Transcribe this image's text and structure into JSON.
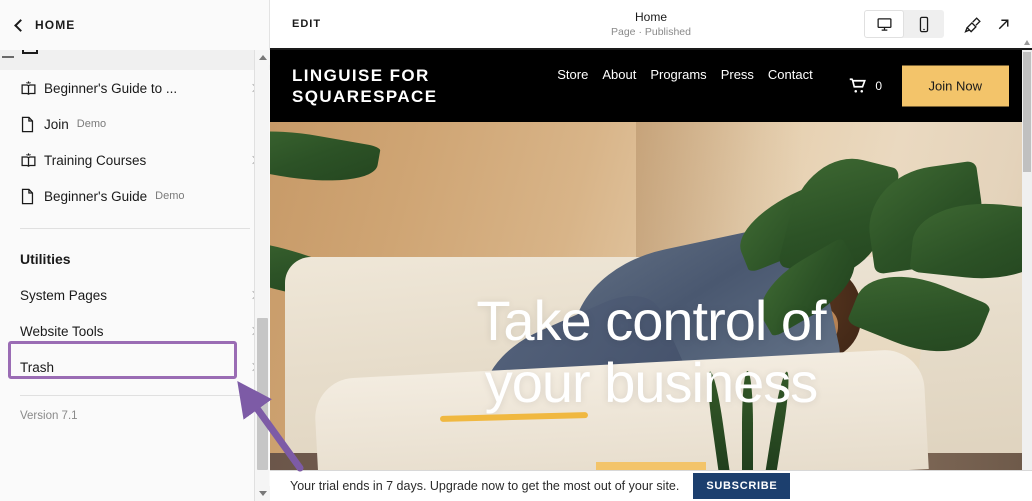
{
  "sidebar": {
    "back_label": "HOME",
    "back_icon": "chevron-left-icon",
    "nav_items": [
      {
        "label": "Beginner's Guide to ...",
        "icon": "book-icon",
        "badge": "",
        "has_chevron": true
      },
      {
        "label": "Join",
        "icon": "page-icon",
        "badge": "Demo",
        "has_chevron": false
      },
      {
        "label": "Training Courses",
        "icon": "book-icon",
        "badge": "",
        "has_chevron": true
      },
      {
        "label": "Beginner's Guide",
        "icon": "page-icon",
        "badge": "Demo",
        "has_chevron": false
      }
    ],
    "utilities_title": "Utilities",
    "utility_items": [
      {
        "label": "System Pages",
        "has_chevron": true,
        "highlighted": false
      },
      {
        "label": "Website Tools",
        "has_chevron": true,
        "highlighted": true
      },
      {
        "label": "Trash",
        "has_chevron": true,
        "highlighted": false
      }
    ],
    "version": "Version 7.1",
    "highlight_color": "#9a6cb4",
    "annotation_arrow_color": "#7d5ba6"
  },
  "topbar": {
    "edit_label": "EDIT",
    "page_title": "Home",
    "page_status": "Page · Published",
    "device_desktop_icon": "desktop-icon",
    "device_mobile_icon": "mobile-icon",
    "desktop_selected": true,
    "brush_icon": "paintbrush-icon",
    "open_icon": "external-link-icon"
  },
  "site": {
    "logo_line1": "LINGUISE FOR",
    "logo_line2": "SQUARESPACE",
    "nav": [
      "Store",
      "About",
      "Programs",
      "Press",
      "Contact"
    ],
    "cart_icon": "shopping-cart-icon",
    "cart_count": "0",
    "join_label": "Join Now",
    "join_color": "#f3c46a",
    "hero_line1": "Take control of",
    "hero_line2": "your business",
    "hero_accent_color": "#f0b840"
  },
  "trial": {
    "message": "Your trial ends in 7 days. Upgrade now to get the most out of your site.",
    "subscribe_label": "SUBSCRIBE",
    "subscribe_color": "#1c3f6e"
  }
}
